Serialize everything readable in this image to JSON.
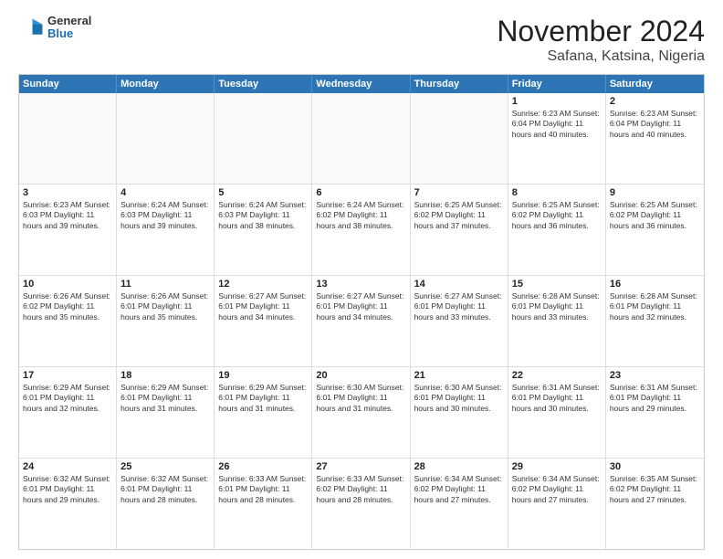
{
  "header": {
    "logo": {
      "line1": "General",
      "line2": "Blue"
    },
    "title": "November 2024",
    "subtitle": "Safana, Katsina, Nigeria"
  },
  "calendar": {
    "weekdays": [
      "Sunday",
      "Monday",
      "Tuesday",
      "Wednesday",
      "Thursday",
      "Friday",
      "Saturday"
    ],
    "weeks": [
      [
        {
          "day": "",
          "empty": true
        },
        {
          "day": "",
          "empty": true
        },
        {
          "day": "",
          "empty": true
        },
        {
          "day": "",
          "empty": true
        },
        {
          "day": "",
          "empty": true
        },
        {
          "day": "1",
          "info": "Sunrise: 6:23 AM\nSunset: 6:04 PM\nDaylight: 11 hours and 40 minutes."
        },
        {
          "day": "2",
          "info": "Sunrise: 6:23 AM\nSunset: 6:04 PM\nDaylight: 11 hours and 40 minutes."
        }
      ],
      [
        {
          "day": "3",
          "info": "Sunrise: 6:23 AM\nSunset: 6:03 PM\nDaylight: 11 hours and 39 minutes."
        },
        {
          "day": "4",
          "info": "Sunrise: 6:24 AM\nSunset: 6:03 PM\nDaylight: 11 hours and 39 minutes."
        },
        {
          "day": "5",
          "info": "Sunrise: 6:24 AM\nSunset: 6:03 PM\nDaylight: 11 hours and 38 minutes."
        },
        {
          "day": "6",
          "info": "Sunrise: 6:24 AM\nSunset: 6:02 PM\nDaylight: 11 hours and 38 minutes."
        },
        {
          "day": "7",
          "info": "Sunrise: 6:25 AM\nSunset: 6:02 PM\nDaylight: 11 hours and 37 minutes."
        },
        {
          "day": "8",
          "info": "Sunrise: 6:25 AM\nSunset: 6:02 PM\nDaylight: 11 hours and 36 minutes."
        },
        {
          "day": "9",
          "info": "Sunrise: 6:25 AM\nSunset: 6:02 PM\nDaylight: 11 hours and 36 minutes."
        }
      ],
      [
        {
          "day": "10",
          "info": "Sunrise: 6:26 AM\nSunset: 6:02 PM\nDaylight: 11 hours and 35 minutes."
        },
        {
          "day": "11",
          "info": "Sunrise: 6:26 AM\nSunset: 6:01 PM\nDaylight: 11 hours and 35 minutes."
        },
        {
          "day": "12",
          "info": "Sunrise: 6:27 AM\nSunset: 6:01 PM\nDaylight: 11 hours and 34 minutes."
        },
        {
          "day": "13",
          "info": "Sunrise: 6:27 AM\nSunset: 6:01 PM\nDaylight: 11 hours and 34 minutes."
        },
        {
          "day": "14",
          "info": "Sunrise: 6:27 AM\nSunset: 6:01 PM\nDaylight: 11 hours and 33 minutes."
        },
        {
          "day": "15",
          "info": "Sunrise: 6:28 AM\nSunset: 6:01 PM\nDaylight: 11 hours and 33 minutes."
        },
        {
          "day": "16",
          "info": "Sunrise: 6:28 AM\nSunset: 6:01 PM\nDaylight: 11 hours and 32 minutes."
        }
      ],
      [
        {
          "day": "17",
          "info": "Sunrise: 6:29 AM\nSunset: 6:01 PM\nDaylight: 11 hours and 32 minutes."
        },
        {
          "day": "18",
          "info": "Sunrise: 6:29 AM\nSunset: 6:01 PM\nDaylight: 11 hours and 31 minutes."
        },
        {
          "day": "19",
          "info": "Sunrise: 6:29 AM\nSunset: 6:01 PM\nDaylight: 11 hours and 31 minutes."
        },
        {
          "day": "20",
          "info": "Sunrise: 6:30 AM\nSunset: 6:01 PM\nDaylight: 11 hours and 31 minutes."
        },
        {
          "day": "21",
          "info": "Sunrise: 6:30 AM\nSunset: 6:01 PM\nDaylight: 11 hours and 30 minutes."
        },
        {
          "day": "22",
          "info": "Sunrise: 6:31 AM\nSunset: 6:01 PM\nDaylight: 11 hours and 30 minutes."
        },
        {
          "day": "23",
          "info": "Sunrise: 6:31 AM\nSunset: 6:01 PM\nDaylight: 11 hours and 29 minutes."
        }
      ],
      [
        {
          "day": "24",
          "info": "Sunrise: 6:32 AM\nSunset: 6:01 PM\nDaylight: 11 hours and 29 minutes."
        },
        {
          "day": "25",
          "info": "Sunrise: 6:32 AM\nSunset: 6:01 PM\nDaylight: 11 hours and 28 minutes."
        },
        {
          "day": "26",
          "info": "Sunrise: 6:33 AM\nSunset: 6:01 PM\nDaylight: 11 hours and 28 minutes."
        },
        {
          "day": "27",
          "info": "Sunrise: 6:33 AM\nSunset: 6:02 PM\nDaylight: 11 hours and 28 minutes."
        },
        {
          "day": "28",
          "info": "Sunrise: 6:34 AM\nSunset: 6:02 PM\nDaylight: 11 hours and 27 minutes."
        },
        {
          "day": "29",
          "info": "Sunrise: 6:34 AM\nSunset: 6:02 PM\nDaylight: 11 hours and 27 minutes."
        },
        {
          "day": "30",
          "info": "Sunrise: 6:35 AM\nSunset: 6:02 PM\nDaylight: 11 hours and 27 minutes."
        }
      ]
    ]
  }
}
